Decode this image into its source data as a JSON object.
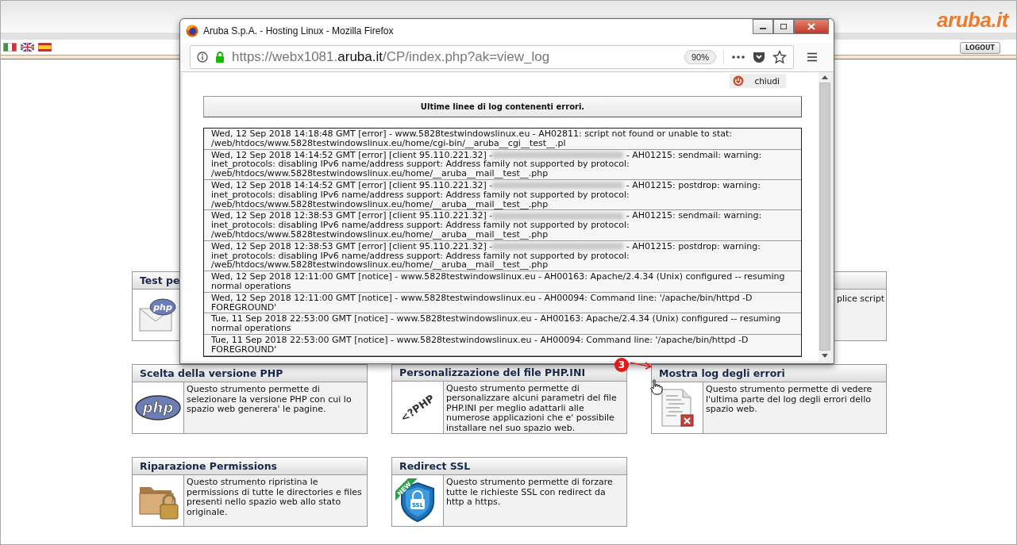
{
  "header": {
    "flags": [
      {
        "kind": "it"
      },
      {
        "kind": "uk"
      },
      {
        "kind": "es"
      }
    ],
    "logo": "aruba.it",
    "logout": "LOGOUT"
  },
  "tool_rows": [
    {
      "cards": [
        {
          "title": "Test pe",
          "kind": "php-mail",
          "icon_text": "php"
        },
        {
          "description": "plice script"
        }
      ]
    },
    {
      "cards": [
        {
          "title": "Scelta della versione PHP",
          "kind": "php-logo",
          "icon_text": "php",
          "description": "Questo strumento permette di selezionare la versione PHP con cui lo spazio web generera' le pagine."
        },
        {
          "title": "Personalizzazione del file PHP.INI",
          "kind": "php-tag",
          "icon_text": "<?PHP",
          "description": "Questo strumento permette di personalizzare alcuni parametri del file PHP.INI per meglio adattarli alle numerose applicazioni che e' possibile installare nel suo spazio web."
        },
        {
          "title": "Mostra log degli errori",
          "kind": "log-file",
          "description": "Questo strumento permette di vedere l'ultima parte del log degli errori dello spazio web."
        }
      ]
    },
    {
      "cards": [
        {
          "title": "Riparazione Permissions",
          "kind": "folder-lock",
          "description": "Questo strumento ripristina le permissions di tutte le directories e files presenti nello spazio web allo stato originale."
        },
        {
          "title": "Redirect SSL",
          "kind": "ssl-shield",
          "icon_text": "SSL",
          "icon_badge": "NEW",
          "description": "Questo strumento permette di forzare tutte le richieste SSL con redirect da http a https."
        }
      ]
    }
  ],
  "annotation": {
    "badge": "3"
  },
  "browser_window": {
    "title": "Aruba S.p.A. - Hosting Linux - Mozilla Firefox",
    "url": {
      "prefix": "https://webx1081.",
      "domain": "aruba.it",
      "path": "/CP/index.php?ak=view_log"
    },
    "zoom": "90%",
    "close_button": "chiudi",
    "log_heading": "Ultime linee di log contenenti errori.",
    "log_entries": [
      {
        "text": "Wed, 12 Sep 2018 14:18:48 GMT [error] - www.5828testwindowslinux.eu - AH02811: script not found or unable to stat: /web/htdocs/www.5828testwindowslinux.eu/home/cgi-bin/__aruba__cgi__test__.pl"
      },
      {
        "text": "Wed, 12 Sep 2018 14:14:52 GMT [error] [client 95.110.221.32] -",
        "text_after": "- AH01215: sendmail: warning: inet_protocols: disabling IPv6 name/address support: Address family not supported by protocol: /web/htdocs/www.5828testwindowslinux.eu/home/__aruba__mail__test__.php"
      },
      {
        "text": "Wed, 12 Sep 2018 14:14:52 GMT [error] [client 95.110.221.32] -",
        "text_after": "- AH01215: postdrop: warning: inet_protocols: disabling IPv6 name/address support: Address family not supported by protocol: /web/htdocs/www.5828testwindowslinux.eu/home/__aruba__mail__test__.php"
      },
      {
        "text": "Wed, 12 Sep 2018 12:38:53 GMT [error] [client 95.110.221.32] -",
        "text_after": "- AH01215: sendmail: warning: inet_protocols: disabling IPv6 name/address support: Address family not supported by protocol: /web/htdocs/www.5828testwindowslinux.eu/home/__aruba__mail__test__.php"
      },
      {
        "text": "Wed, 12 Sep 2018 12:38:53 GMT [error] [client 95.110.221.32] -",
        "text_after": "- AH01215: postdrop: warning: inet_protocols: disabling IPv6 name/address support: Address family not supported by protocol: /web/htdocs/www.5828testwindowslinux.eu/home/__aruba__mail__test__.php"
      },
      {
        "text": "Wed, 12 Sep 2018 12:11:00 GMT [notice] - www.5828testwindowslinux.eu - AH00163: Apache/2.4.34 (Unix) configured -- resuming normal operations"
      },
      {
        "text": "Wed, 12 Sep 2018 12:11:00 GMT [notice] - www.5828testwindowslinux.eu - AH00094: Command line: '/apache/bin/httpd -D FOREGROUND'"
      },
      {
        "text": "Tue, 11 Sep 2018 22:53:00 GMT [notice] - www.5828testwindowslinux.eu - AH00163: Apache/2.4.34 (Unix) configured -- resuming normal operations"
      },
      {
        "text": "Tue, 11 Sep 2018 22:53:00 GMT [notice] - www.5828testwindowslinux.eu - AH00094: Command line: '/apache/bin/httpd -D FOREGROUND'"
      }
    ]
  }
}
